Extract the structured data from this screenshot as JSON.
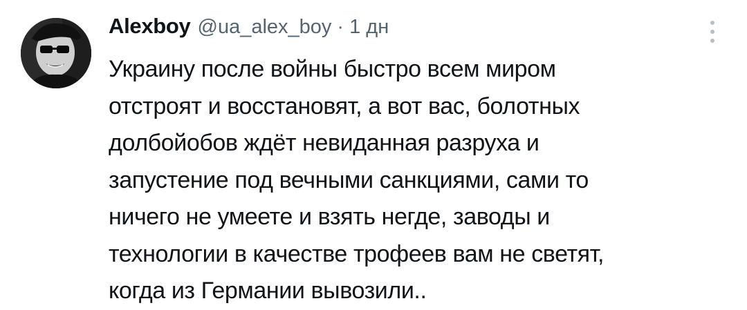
{
  "tweet": {
    "author_name": "Alexboy",
    "handle": "@ua_alex_boy",
    "separator": "·",
    "time": "1 дн",
    "lines": [
      "Украину после войны быстро всем миром",
      "отстроят и восстановят, а вот вас, болотных",
      "долбойобов ждёт невиданная разруха и",
      "запустение под вечными санкциями, сами то",
      "ничего не умеете и взять негде, заводы и",
      "технологии в качестве трофеев вам не светят,",
      "когда из Германии вывозили.."
    ]
  },
  "icons": {
    "avatar": "avatar-photo",
    "more": "more-options-icon"
  },
  "colors": {
    "text_primary": "#0f1419",
    "text_secondary": "#536471",
    "background": "#ffffff",
    "more_icon": "#b7bec4"
  }
}
